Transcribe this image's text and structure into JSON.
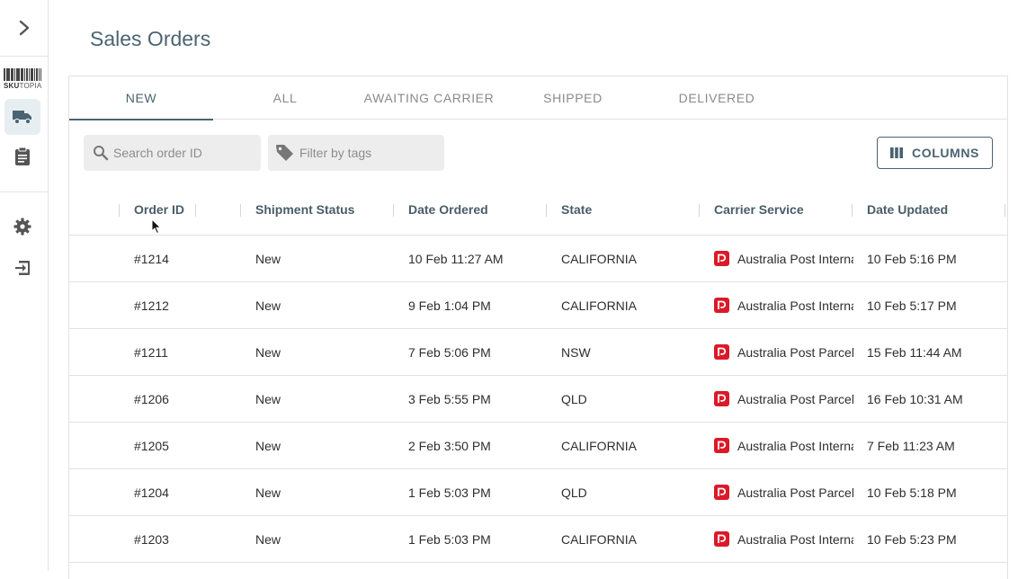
{
  "sidebar": {
    "logo_text_bold": "SKU",
    "logo_text_rest": "TOPIA",
    "icons": [
      "chevron-right-icon",
      "truck-icon",
      "clipboard-icon",
      "gear-icon",
      "logout-icon"
    ]
  },
  "page": {
    "title": "Sales Orders"
  },
  "tabs": [
    {
      "label": "NEW",
      "active": true
    },
    {
      "label": "ALL",
      "active": false
    },
    {
      "label": "AWAITING CARRIER",
      "active": false
    },
    {
      "label": "SHIPPED",
      "active": false
    },
    {
      "label": "DELIVERED",
      "active": false
    }
  ],
  "toolbar": {
    "search_placeholder": "Search order ID",
    "tags_placeholder": "Filter by tags",
    "columns_label": "COLUMNS"
  },
  "table": {
    "columns": [
      "Order ID",
      "Shipment Status",
      "Date Ordered",
      "State",
      "Carrier Service",
      "Date Updated"
    ],
    "rows": [
      {
        "order_id": "#1214",
        "status": "New",
        "date_ordered": "10 Feb 11:27 AM",
        "state": "CALIFORNIA",
        "carrier": "Australia Post International",
        "date_updated": "10 Feb 5:16 PM"
      },
      {
        "order_id": "#1212",
        "status": "New",
        "date_ordered": "9 Feb 1:04 PM",
        "state": "CALIFORNIA",
        "carrier": "Australia Post International",
        "date_updated": "10 Feb 5:17 PM"
      },
      {
        "order_id": "#1211",
        "status": "New",
        "date_ordered": "7 Feb 5:06 PM",
        "state": "NSW",
        "carrier": "Australia Post Parcel Post",
        "date_updated": "15 Feb 11:44 AM"
      },
      {
        "order_id": "#1206",
        "status": "New",
        "date_ordered": "3 Feb 5:55 PM",
        "state": "QLD",
        "carrier": "Australia Post Parcel Post",
        "date_updated": "16 Feb 10:31 AM"
      },
      {
        "order_id": "#1205",
        "status": "New",
        "date_ordered": "2 Feb 3:50 PM",
        "state": "CALIFORNIA",
        "carrier": "Australia Post International",
        "date_updated": "7 Feb 11:23 AM"
      },
      {
        "order_id": "#1204",
        "status": "New",
        "date_ordered": "1 Feb 5:03 PM",
        "state": "QLD",
        "carrier": "Australia Post Parcel Post",
        "date_updated": "10 Feb 5:18 PM"
      },
      {
        "order_id": "#1203",
        "status": "New",
        "date_ordered": "1 Feb 5:03 PM",
        "state": "CALIFORNIA",
        "carrier": "Australia Post International",
        "date_updated": "10 Feb 5:23 PM"
      }
    ]
  },
  "colors": {
    "accent": "#4a6372",
    "carrier_brand": "#dc1928",
    "active_nav_bg": "#e7eef1"
  }
}
